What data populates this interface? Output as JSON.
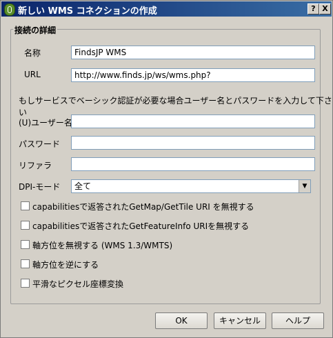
{
  "window": {
    "title": "新しい WMS コネクションの作成",
    "help_label": "?",
    "close_label": "X"
  },
  "group": {
    "title": "接続の詳細"
  },
  "fields": {
    "name": {
      "label": "名称",
      "value": "FindsJP WMS"
    },
    "url": {
      "label": "URL",
      "value": "http://www.finds.jp/ws/wms.php?"
    },
    "instructions": "もしサービスでベーシック認証が必要な場合ユーザー名とパスワードを入力して下さい",
    "username": {
      "label": "(U)ユーザー名",
      "value": ""
    },
    "password": {
      "label": "パスワード",
      "value": ""
    },
    "referer": {
      "label": "リファラ",
      "value": ""
    },
    "dpi": {
      "label": "DPI-モード",
      "value": "全て",
      "arrow": "▼"
    }
  },
  "checkboxes": [
    {
      "label": "capabilitiesで返答されたGetMap/GetTile URI を無視する",
      "checked": false
    },
    {
      "label": "capabilitiesで返答されたGetFeatureInfo URIを無視する",
      "checked": false
    },
    {
      "label": "軸方位を無視する (WMS 1.3/WMTS)",
      "checked": false
    },
    {
      "label": "軸方位を逆にする",
      "checked": false
    },
    {
      "label": "平滑なピクセル座標変換",
      "checked": false
    }
  ],
  "buttons": {
    "ok": "OK",
    "cancel": "キャンセル",
    "help": "ヘルプ"
  }
}
